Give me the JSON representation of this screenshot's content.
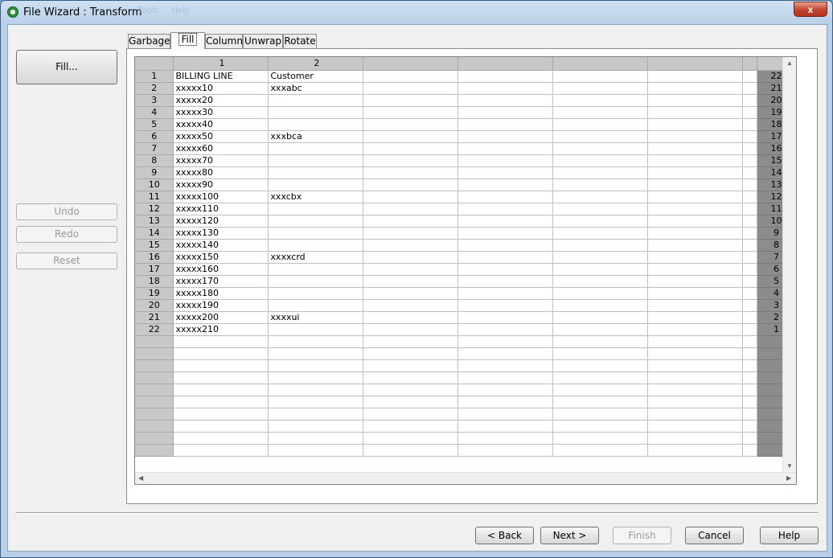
{
  "window": {
    "title": "File Wizard : Transform",
    "ghost_menu": [
      "Tools",
      "Help"
    ],
    "close_glyph": "x"
  },
  "left_panel": {
    "fill_button": "Fill...",
    "undo": "Undo",
    "redo": "Redo",
    "reset": "Reset"
  },
  "tabs": [
    "Garbage",
    "Fill",
    "Column",
    "Unwrap",
    "Rotate"
  ],
  "active_tab": "Fill",
  "grid": {
    "column_headers": [
      "1",
      "2"
    ],
    "rows": [
      {
        "n": "1",
        "c1": "BILLING LINE",
        "c2": "Customer",
        "r": "22"
      },
      {
        "n": "2",
        "c1": "xxxxx10",
        "c2": "xxxabc",
        "r": "21"
      },
      {
        "n": "3",
        "c1": "xxxxx20",
        "c2": "",
        "r": "20"
      },
      {
        "n": "4",
        "c1": "xxxxx30",
        "c2": "",
        "r": "19"
      },
      {
        "n": "5",
        "c1": "xxxxx40",
        "c2": "",
        "r": "18"
      },
      {
        "n": "6",
        "c1": "xxxxx50",
        "c2": "xxxbca",
        "r": "17"
      },
      {
        "n": "7",
        "c1": "xxxxx60",
        "c2": "",
        "r": "16"
      },
      {
        "n": "8",
        "c1": "xxxxx70",
        "c2": "",
        "r": "15"
      },
      {
        "n": "9",
        "c1": "xxxxx80",
        "c2": "",
        "r": "14"
      },
      {
        "n": "10",
        "c1": "xxxxx90",
        "c2": "",
        "r": "13"
      },
      {
        "n": "11",
        "c1": "xxxxx100",
        "c2": "xxxcbx",
        "r": "12"
      },
      {
        "n": "12",
        "c1": "xxxxx110",
        "c2": "",
        "r": "11"
      },
      {
        "n": "13",
        "c1": "xxxxx120",
        "c2": "",
        "r": "10"
      },
      {
        "n": "14",
        "c1": "xxxxx130",
        "c2": "",
        "r": "9"
      },
      {
        "n": "15",
        "c1": "xxxxx140",
        "c2": "",
        "r": "8"
      },
      {
        "n": "16",
        "c1": "xxxxx150",
        "c2": "xxxxcrd",
        "r": "7"
      },
      {
        "n": "17",
        "c1": "xxxxx160",
        "c2": "",
        "r": "6"
      },
      {
        "n": "18",
        "c1": "xxxxx170",
        "c2": "",
        "r": "5"
      },
      {
        "n": "19",
        "c1": "xxxxx180",
        "c2": "",
        "r": "4"
      },
      {
        "n": "20",
        "c1": "xxxxx190",
        "c2": "",
        "r": "3"
      },
      {
        "n": "21",
        "c1": "xxxxx200",
        "c2": "xxxxui",
        "r": "2"
      },
      {
        "n": "22",
        "c1": "xxxxx210",
        "c2": "",
        "r": "1"
      }
    ]
  },
  "footer": {
    "back": "< Back",
    "next": "Next >",
    "finish": "Finish",
    "cancel": "Cancel",
    "help": "Help"
  },
  "icons": {
    "scroll_up": "▲",
    "scroll_down": "▼",
    "scroll_left": "◀",
    "scroll_right": "▶"
  }
}
